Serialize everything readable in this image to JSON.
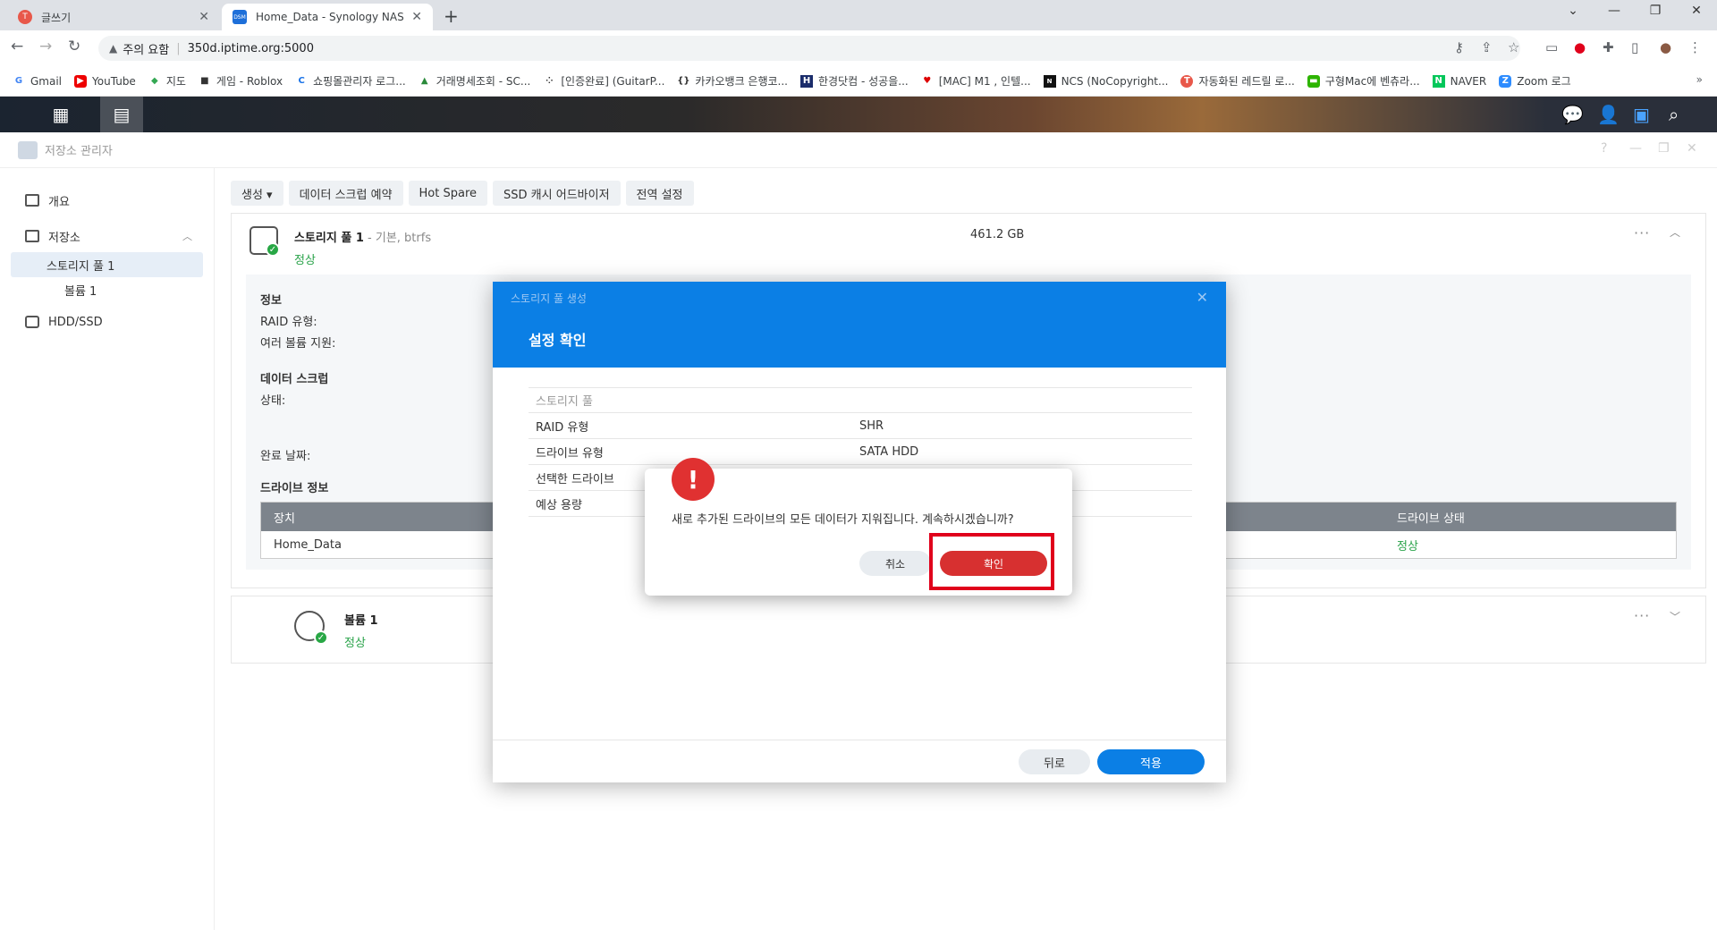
{
  "browser": {
    "tabs": [
      {
        "title": "글쓰기",
        "favicon": "T"
      },
      {
        "title": "Home_Data - Synology NAS",
        "favicon": "DSM"
      }
    ],
    "address": {
      "warning": "주의 요함",
      "url": "350d.iptime.org:5000"
    },
    "bookmarks": [
      {
        "label": "Gmail",
        "icon": "G"
      },
      {
        "label": "YouTube",
        "icon": "▶"
      },
      {
        "label": "지도",
        "icon": "◆"
      },
      {
        "label": "게임 - Roblox",
        "icon": "■"
      },
      {
        "label": "쇼핑몰관리자 로그...",
        "icon": "C"
      },
      {
        "label": "거래명세조회 - SC...",
        "icon": "▲"
      },
      {
        "label": "[인증완료] (GuitarP...",
        "icon": "⁘"
      },
      {
        "label": "카카오뱅크 은행코...",
        "icon": "{}"
      },
      {
        "label": "한경닷컴 - 성공을...",
        "icon": "H"
      },
      {
        "label": "[MAC] M1 , 인텔...",
        "icon": "♥"
      },
      {
        "label": "NCS (NoCopyright...",
        "icon": "N"
      },
      {
        "label": "자동화된 레드릴 로...",
        "icon": "T"
      },
      {
        "label": "구형Mac에 벤츄라...",
        "icon": "▬"
      },
      {
        "label": "NAVER",
        "icon": "N"
      },
      {
        "label": "Zoom 로그",
        "icon": "Z"
      }
    ]
  },
  "app": {
    "title": "저장소 관리자",
    "sidebar": {
      "overview": "개요",
      "storage": "저장소",
      "pool": "스토리지 풀 1",
      "volume": "볼륨 1",
      "hdd": "HDD/SSD"
    },
    "toolbar": [
      "생성 ▾",
      "데이터 스크럽 예약",
      "Hot Spare",
      "SSD 캐시 어드바이저",
      "전역 설정"
    ],
    "pool": {
      "name": "스토리지 풀 1",
      "sub": " - 기본, btrfs",
      "status": "정상",
      "size": "461.2 GB",
      "info_title": "정보",
      "raid_label": "RAID 유형:",
      "multi_label": "여러 볼륨 지원:",
      "scrub_title": "데이터 스크럽",
      "state_label": "상태:",
      "done_label": "완료 날짜:",
      "drive_title": "드라이브 정보",
      "col_device": "장치",
      "col_status": "드라이브 상태",
      "device": "Home_Data",
      "device_status": "정상"
    },
    "volume": {
      "name": "볼륨 1",
      "status": "정상"
    }
  },
  "wizard": {
    "crumb": "스토리지 풀 생성",
    "title": "설정 확인",
    "table_header": "스토리지 풀",
    "rows": [
      {
        "key": "RAID 유형",
        "value": "SHR"
      },
      {
        "key": "드라이브 유형",
        "value": "SATA HDD"
      },
      {
        "key": "선택한 드라이브",
        "value": ""
      },
      {
        "key": "예상 용량",
        "value": ""
      }
    ],
    "back": "뒤로",
    "apply": "적용"
  },
  "alert": {
    "icon": "!",
    "message": "새로 추가된 드라이브의 모든 데이터가 지워집니다. 계속하시겠습니까?",
    "cancel": "취소",
    "ok": "확인"
  },
  "colors": {
    "accent": "#0b7fe5",
    "danger": "#d73030",
    "ok": "#2aa34a",
    "highlight": "#e0001b"
  }
}
